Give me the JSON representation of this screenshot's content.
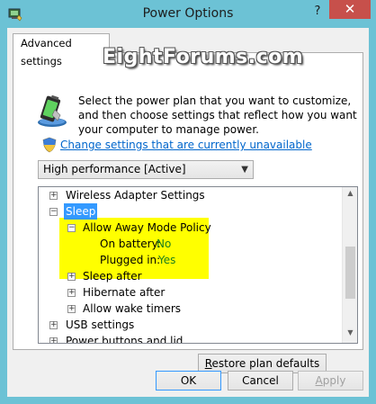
{
  "window": {
    "title": "Power Options",
    "help_label": "?",
    "close_label": "✕"
  },
  "watermark": "EightForums.com",
  "tab": {
    "label": "Advanced settings"
  },
  "description": "Select the power plan that you want to customize, and then choose settings that reflect how you want your computer to manage power.",
  "change_link": "Change settings that are currently unavailable",
  "plan_select": {
    "value": "High performance [Active]"
  },
  "tree": {
    "items": [
      {
        "label": "Wireless Adapter Settings",
        "expander": "+"
      },
      {
        "label": "Sleep",
        "expander": "−"
      },
      {
        "label": "Allow Away Mode Policy",
        "expander": "−"
      },
      {
        "label": "On battery:",
        "value": "No"
      },
      {
        "label": "Plugged in:",
        "value": "Yes"
      },
      {
        "label": "Sleep after",
        "expander": "+"
      },
      {
        "label": "Hibernate after",
        "expander": "+"
      },
      {
        "label": "Allow wake timers",
        "expander": "+"
      },
      {
        "label": "USB settings",
        "expander": "+"
      },
      {
        "label": "Power buttons and lid",
        "expander": "+"
      }
    ]
  },
  "buttons": {
    "restore_first": "R",
    "restore_rest": "estore plan defaults",
    "ok": "OK",
    "cancel": "Cancel",
    "apply_first": "A",
    "apply_rest": "pply"
  },
  "colors": {
    "titlebar": "#6cc2d5",
    "close": "#c7504b",
    "selection": "#3399ff",
    "highlight": "#ffff00",
    "link": "#0066cc"
  }
}
